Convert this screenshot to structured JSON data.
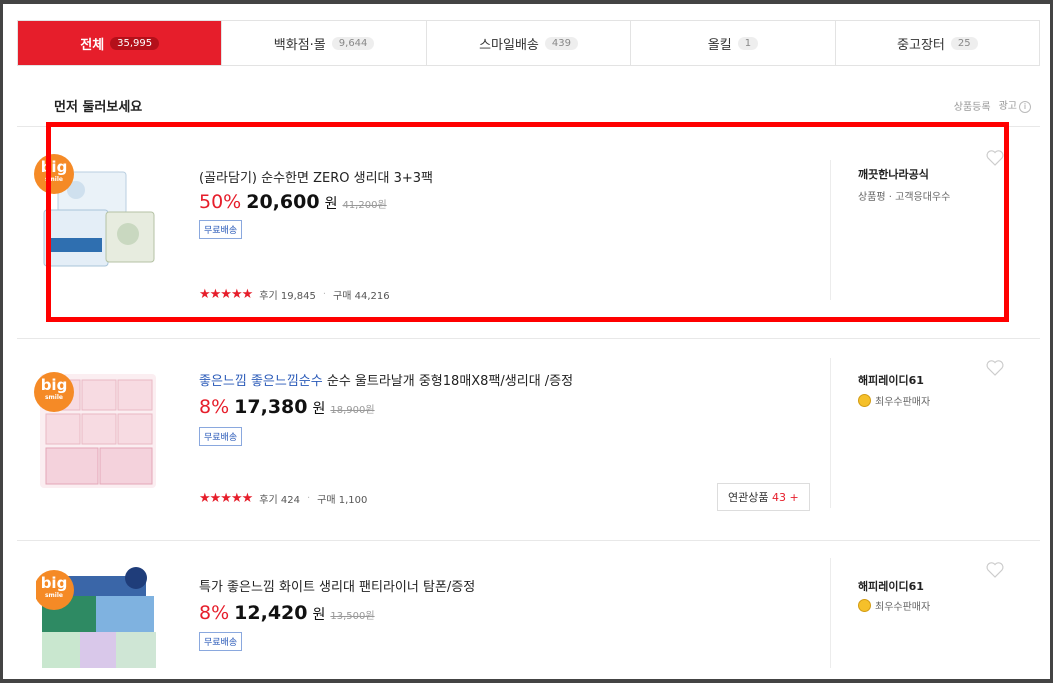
{
  "tabs": [
    {
      "label": "전체",
      "count": "35,995",
      "active": true
    },
    {
      "label": "백화점·몰",
      "count": "9,644",
      "active": false
    },
    {
      "label": "스마일배송",
      "count": "439",
      "active": false
    },
    {
      "label": "올킬",
      "count": "1",
      "active": false
    },
    {
      "label": "중고장터",
      "count": "25",
      "active": false
    }
  ],
  "section": {
    "title": "먼저 둘러보세요",
    "register": "상품등록",
    "ad": "광고",
    "info_icon": "i"
  },
  "products": [
    {
      "badge": "big",
      "badge_sub": "smile",
      "title_highlight": "",
      "title": "(골라담기) 순수한면 ZERO 생리대 3+3팩",
      "discount": "50%",
      "price": "20,600",
      "won": "원",
      "original": "41,200원",
      "shipping": "무료배송",
      "stars": "★★★★★",
      "reviews": "후기 19,845",
      "purchases": "구매 44,216",
      "related": "",
      "seller": "깨끗한나라공식",
      "seller_badge": "상품평 · 고객응대우수"
    },
    {
      "badge": "big",
      "badge_sub": "smile",
      "title_highlight": "좋은느낌 좋은느낌순수",
      "title": " 순수 울트라날개 중형18매X8팩/생리대 /증정",
      "discount": "8%",
      "price": "17,380",
      "won": "원",
      "original": "18,900원",
      "shipping": "무료배송",
      "stars": "★★★★★",
      "reviews": "후기 424",
      "purchases": "구매 1,100",
      "related": "연관상품",
      "related_count": "43",
      "related_plus": "+",
      "seller": "해피레이디61",
      "seller_badge": "최우수판매자"
    },
    {
      "badge": "big",
      "badge_sub": "smile",
      "title_highlight": "",
      "title": "특가 좋은느낌 화이트 생리대 팬티라이너 탐폰/증정",
      "discount": "8%",
      "price": "12,420",
      "won": "원",
      "original": "13,500원",
      "shipping": "무료배송",
      "seller": "해피레이디61",
      "seller_badge": "최우수판매자"
    }
  ],
  "colors": {
    "accent": "#e61e2b",
    "link": "#2a5ab8",
    "highlight_box": "#ff0000"
  }
}
